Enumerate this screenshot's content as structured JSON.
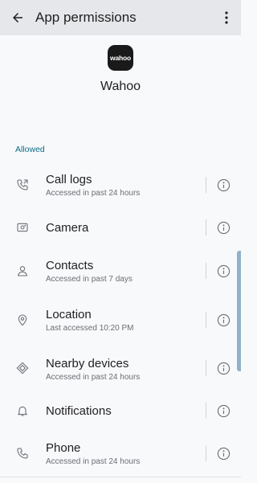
{
  "appbar": {
    "title": "App permissions",
    "back_icon": "arrow-back-icon",
    "more_icon": "more-vert-icon"
  },
  "app": {
    "logo_text": "wahoo",
    "name": "Wahoo"
  },
  "section": {
    "label": "Allowed",
    "color": "#0b6b86"
  },
  "permissions": [
    {
      "title": "Call logs",
      "subtitle": "Accessed in past 24 hours",
      "icon": "call-log-icon"
    },
    {
      "title": "Camera",
      "subtitle": "",
      "icon": "camera-icon"
    },
    {
      "title": "Contacts",
      "subtitle": "Accessed in past 7 days",
      "icon": "contacts-icon"
    },
    {
      "title": "Location",
      "subtitle": "Last accessed 10:20 PM",
      "icon": "location-icon"
    },
    {
      "title": "Nearby devices",
      "subtitle": "Accessed in past 24 hours",
      "icon": "nearby-devices-icon"
    },
    {
      "title": "Notifications",
      "subtitle": "",
      "icon": "bell-icon"
    },
    {
      "title": "Phone",
      "subtitle": "Accessed in past 24 hours",
      "icon": "phone-icon"
    }
  ]
}
